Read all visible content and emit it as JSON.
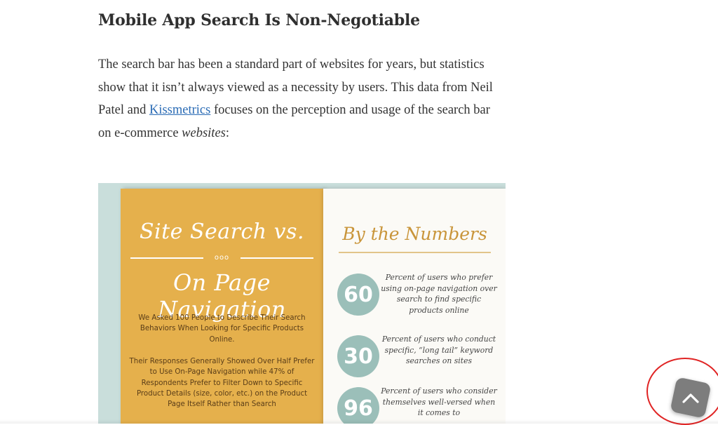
{
  "article": {
    "heading": "Mobile App Search Is Non-Negotiable",
    "paragraph": {
      "before_link": "The search bar has been a standard part of websites for years, but statistics show that it isn’t always viewed as a necessity by users. This data from Neil Patel and ",
      "link_text": "Kissmetrics",
      "after_link": " focuses on the perception and usage of the search bar on e-commerce ",
      "emphasis": "websites",
      "end": ":"
    }
  },
  "infographic": {
    "left_title_line1": "Site Search vs.",
    "ornament_dots": "ooo",
    "left_title_line2": "On Page Navigation",
    "left_paragraph_1": "We Asked 100 People to Describe Their Search Behaviors When Looking for Specific Products Online.",
    "left_paragraph_2": "Their Responses Generally Showed Over Half Prefer to Use On-Page Navigation while 47% of Respondents Prefer to Filter Down to Specific Product Details (size, color, etc.) on the Product Page Itself Rather than Search",
    "right_title": "By the Numbers",
    "stats": [
      {
        "number": "60",
        "text": "Percent of users who prefer using on-page navigation over search to find specific products online"
      },
      {
        "number": "30",
        "text": "Percent of users who conduct specific, “long tail” keyword searches on sites"
      },
      {
        "number": "96",
        "text": "Percent of users who consider themselves well-versed when it comes to"
      }
    ]
  },
  "scroll_top": {
    "icon": "chevron-up-icon"
  },
  "colors": {
    "link": "#2a6bb5",
    "infographic_bg": "#c9dedb",
    "panel_gold": "#e5b04c",
    "stat_circle": "#9bbfb9",
    "highlight_ring": "#e02424",
    "scroll_button": "#7d7d7d"
  }
}
